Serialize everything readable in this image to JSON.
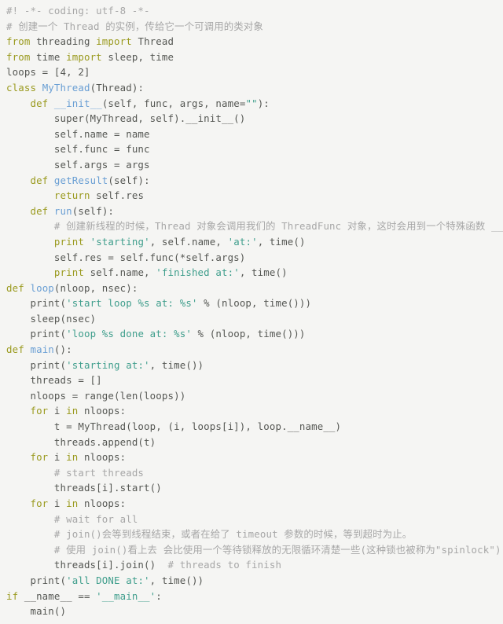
{
  "document": {
    "type": "source-code-listing",
    "language": "python",
    "background_color": "#f5f5f3",
    "colors": {
      "keyword": "#9a9a1e",
      "definition_name": "#6a9fd4",
      "string": "#3f9e8c",
      "comment": "#a7a7a7",
      "plain": "#555753"
    },
    "lines": [
      {
        "id": 1,
        "indent": 0,
        "tokens": [
          {
            "c": "com",
            "t": "#! -*- coding: utf-8 -*-"
          }
        ]
      },
      {
        "id": 2,
        "indent": 0,
        "tokens": [
          {
            "c": "com",
            "t": "# 创建一个 Thread 的实例，传给它一个可调用的类对象"
          }
        ]
      },
      {
        "id": 3,
        "indent": 0,
        "tokens": [
          {
            "c": "kw",
            "t": "from"
          },
          {
            "c": "plain",
            "t": " threading "
          },
          {
            "c": "kw",
            "t": "import"
          },
          {
            "c": "plain",
            "t": " Thread"
          }
        ]
      },
      {
        "id": 4,
        "indent": 0,
        "tokens": [
          {
            "c": "kw",
            "t": "from"
          },
          {
            "c": "plain",
            "t": " time "
          },
          {
            "c": "kw",
            "t": "import"
          },
          {
            "c": "plain",
            "t": " sleep, time"
          }
        ]
      },
      {
        "id": 5,
        "indent": 0,
        "tokens": [
          {
            "c": "plain",
            "t": "loops = [4, 2]"
          }
        ]
      },
      {
        "id": 6,
        "indent": 0,
        "tokens": [
          {
            "c": "kw",
            "t": "class"
          },
          {
            "c": "plain",
            "t": " "
          },
          {
            "c": "name",
            "t": "MyThread"
          },
          {
            "c": "plain",
            "t": "(Thread):"
          }
        ]
      },
      {
        "id": 7,
        "indent": 1,
        "tokens": [
          {
            "c": "kw",
            "t": "def"
          },
          {
            "c": "plain",
            "t": " "
          },
          {
            "c": "name",
            "t": "__init__"
          },
          {
            "c": "plain",
            "t": "(self, func, args, name="
          },
          {
            "c": "str",
            "t": "\"\""
          },
          {
            "c": "plain",
            "t": "):"
          }
        ]
      },
      {
        "id": 8,
        "indent": 2,
        "tokens": [
          {
            "c": "plain",
            "t": "super(MyThread, self).__init__()"
          }
        ]
      },
      {
        "id": 9,
        "indent": 2,
        "tokens": [
          {
            "c": "plain",
            "t": "self.name = name"
          }
        ]
      },
      {
        "id": 10,
        "indent": 2,
        "tokens": [
          {
            "c": "plain",
            "t": "self.func = func"
          }
        ]
      },
      {
        "id": 11,
        "indent": 2,
        "tokens": [
          {
            "c": "plain",
            "t": "self.args = args"
          }
        ]
      },
      {
        "id": 12,
        "indent": 1,
        "tokens": [
          {
            "c": "kw",
            "t": "def"
          },
          {
            "c": "plain",
            "t": " "
          },
          {
            "c": "name",
            "t": "getResult"
          },
          {
            "c": "plain",
            "t": "(self):"
          }
        ]
      },
      {
        "id": 13,
        "indent": 2,
        "tokens": [
          {
            "c": "kw",
            "t": "return"
          },
          {
            "c": "plain",
            "t": " self.res"
          }
        ]
      },
      {
        "id": 14,
        "indent": 1,
        "tokens": [
          {
            "c": "kw",
            "t": "def"
          },
          {
            "c": "plain",
            "t": " "
          },
          {
            "c": "name",
            "t": "run"
          },
          {
            "c": "plain",
            "t": "(self):"
          }
        ]
      },
      {
        "id": 15,
        "indent": 2,
        "tokens": [
          {
            "c": "com",
            "t": "# 创建新线程的时候，Thread 对象会调用我们的 ThreadFunc 对象，这时会用到一个特殊函数 __call__()。"
          }
        ]
      },
      {
        "id": 16,
        "indent": 2,
        "tokens": [
          {
            "c": "kw",
            "t": "print"
          },
          {
            "c": "plain",
            "t": " "
          },
          {
            "c": "str",
            "t": "'starting'"
          },
          {
            "c": "plain",
            "t": ", self.name, "
          },
          {
            "c": "str",
            "t": "'at:'"
          },
          {
            "c": "plain",
            "t": ", time()"
          }
        ]
      },
      {
        "id": 17,
        "indent": 2,
        "tokens": [
          {
            "c": "plain",
            "t": "self.res = self.func(*self.args)"
          }
        ]
      },
      {
        "id": 18,
        "indent": 2,
        "tokens": [
          {
            "c": "kw",
            "t": "print"
          },
          {
            "c": "plain",
            "t": " self.name, "
          },
          {
            "c": "str",
            "t": "'finished at:'"
          },
          {
            "c": "plain",
            "t": ", time()"
          }
        ]
      },
      {
        "id": 19,
        "indent": 0,
        "tokens": [
          {
            "c": "kw",
            "t": "def"
          },
          {
            "c": "plain",
            "t": " "
          },
          {
            "c": "name",
            "t": "loop"
          },
          {
            "c": "plain",
            "t": "(nloop, nsec):"
          }
        ]
      },
      {
        "id": 20,
        "indent": 1,
        "tokens": [
          {
            "c": "plain",
            "t": "print("
          },
          {
            "c": "str",
            "t": "'start loop %s at: %s'"
          },
          {
            "c": "plain",
            "t": " % (nloop, time()))"
          }
        ]
      },
      {
        "id": 21,
        "indent": 1,
        "tokens": [
          {
            "c": "plain",
            "t": "sleep(nsec)"
          }
        ]
      },
      {
        "id": 22,
        "indent": 1,
        "tokens": [
          {
            "c": "plain",
            "t": "print("
          },
          {
            "c": "str",
            "t": "'loop %s done at: %s'"
          },
          {
            "c": "plain",
            "t": " % (nloop, time()))"
          }
        ]
      },
      {
        "id": 23,
        "indent": 0,
        "tokens": [
          {
            "c": "kw",
            "t": "def"
          },
          {
            "c": "plain",
            "t": " "
          },
          {
            "c": "name",
            "t": "main"
          },
          {
            "c": "plain",
            "t": "():"
          }
        ]
      },
      {
        "id": 24,
        "indent": 1,
        "tokens": [
          {
            "c": "plain",
            "t": "print("
          },
          {
            "c": "str",
            "t": "'starting at:'"
          },
          {
            "c": "plain",
            "t": ", time())"
          }
        ]
      },
      {
        "id": 25,
        "indent": 1,
        "tokens": [
          {
            "c": "plain",
            "t": "threads = []"
          }
        ]
      },
      {
        "id": 26,
        "indent": 1,
        "tokens": [
          {
            "c": "plain",
            "t": "nloops = range(len(loops))"
          }
        ]
      },
      {
        "id": 27,
        "indent": 1,
        "tokens": [
          {
            "c": "kw",
            "t": "for"
          },
          {
            "c": "plain",
            "t": " i "
          },
          {
            "c": "kw",
            "t": "in"
          },
          {
            "c": "plain",
            "t": " nloops:"
          }
        ]
      },
      {
        "id": 28,
        "indent": 2,
        "tokens": [
          {
            "c": "plain",
            "t": "t = MyThread(loop, (i, loops[i]), loop.__name__)"
          }
        ]
      },
      {
        "id": 29,
        "indent": 2,
        "tokens": [
          {
            "c": "plain",
            "t": "threads.append(t)"
          }
        ]
      },
      {
        "id": 30,
        "indent": 1,
        "tokens": [
          {
            "c": "kw",
            "t": "for"
          },
          {
            "c": "plain",
            "t": " i "
          },
          {
            "c": "kw",
            "t": "in"
          },
          {
            "c": "plain",
            "t": " nloops:"
          }
        ]
      },
      {
        "id": 31,
        "indent": 2,
        "tokens": [
          {
            "c": "com",
            "t": "# start threads"
          }
        ]
      },
      {
        "id": 32,
        "indent": 2,
        "tokens": [
          {
            "c": "plain",
            "t": "threads[i].start()"
          }
        ]
      },
      {
        "id": 33,
        "indent": 1,
        "tokens": [
          {
            "c": "kw",
            "t": "for"
          },
          {
            "c": "plain",
            "t": " i "
          },
          {
            "c": "kw",
            "t": "in"
          },
          {
            "c": "plain",
            "t": " nloops:"
          }
        ]
      },
      {
        "id": 34,
        "indent": 2,
        "tokens": [
          {
            "c": "com",
            "t": "# wait for all"
          }
        ]
      },
      {
        "id": 35,
        "indent": 2,
        "tokens": [
          {
            "c": "com",
            "t": "# join()会等到线程结束，或者在给了 timeout 参数的时候，等到超时为止。"
          }
        ]
      },
      {
        "id": 36,
        "indent": 2,
        "tokens": [
          {
            "c": "com",
            "t": "# 使用 join()看上去 会比使用一个等待锁释放的无限循环清楚一些(这种锁也被称为\"spinlock\")"
          }
        ]
      },
      {
        "id": 37,
        "indent": 2,
        "tokens": [
          {
            "c": "plain",
            "t": "threads[i].join()"
          },
          {
            "c": "plain",
            "t": "  "
          },
          {
            "c": "com",
            "t": "# threads to finish"
          }
        ]
      },
      {
        "id": 38,
        "indent": 1,
        "tokens": [
          {
            "c": "plain",
            "t": "print("
          },
          {
            "c": "str",
            "t": "'all DONE at:'"
          },
          {
            "c": "plain",
            "t": ", time())"
          }
        ]
      },
      {
        "id": 39,
        "indent": 0,
        "tokens": [
          {
            "c": "kw",
            "t": "if"
          },
          {
            "c": "plain",
            "t": " __name__ == "
          },
          {
            "c": "str",
            "t": "'__main__'"
          },
          {
            "c": "plain",
            "t": ":"
          }
        ]
      },
      {
        "id": 40,
        "indent": 1,
        "tokens": [
          {
            "c": "plain",
            "t": "main()"
          }
        ]
      }
    ]
  }
}
